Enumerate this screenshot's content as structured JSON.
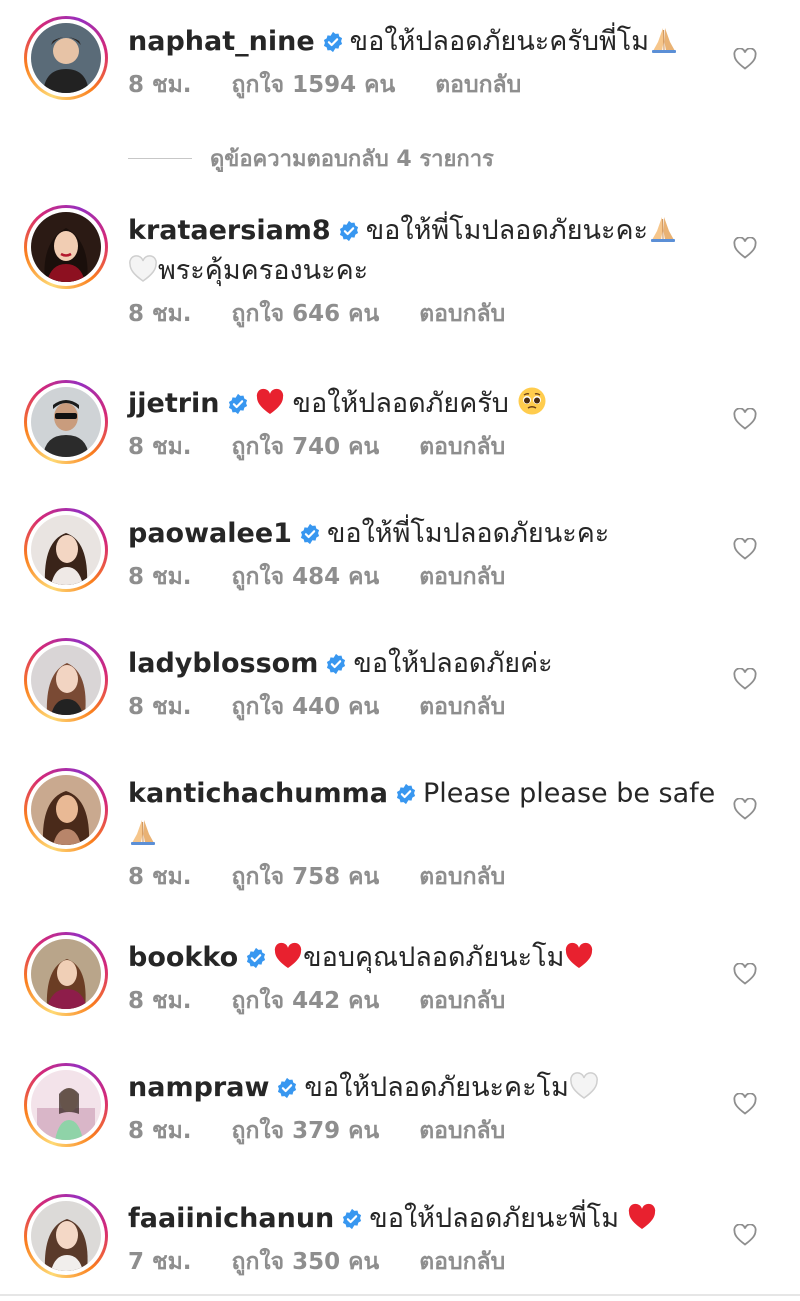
{
  "view_replies": "ดูข้อความตอบกลับ 4 รายการ",
  "reply_label": "ตอบกลับ",
  "colors": {
    "username": "#262626",
    "meta": "#8e8e8e",
    "verified": "#3897f0",
    "heart": "#ed4956"
  },
  "comments": [
    {
      "username": "naphat_nine",
      "verified": true,
      "text_lines": [
        "ขอให้ปลอดภัยนะครับพี่โม"
      ],
      "emoji": [
        "folded-hands"
      ],
      "time": "8 ชม.",
      "likes": "ถูกใจ 1594 คน"
    },
    {
      "username": "krataersiam8",
      "verified": true,
      "text_lines": [
        "ขอให้พี่โมปลอดภัยนะคะ",
        "พระคุ้มครองนะคะ"
      ],
      "emoji": [
        "folded-hands",
        "white-heart"
      ],
      "time": "8 ชม.",
      "likes": "ถูกใจ 646 คน"
    },
    {
      "username": "jjetrin",
      "verified": true,
      "text_lines": [
        "ขอให้ปลอดภัยครับ"
      ],
      "emoji": [
        "red-heart",
        "pleading-face"
      ],
      "time": "8 ชม.",
      "likes": "ถูกใจ 740 คน"
    },
    {
      "username": "paowalee1",
      "verified": true,
      "text_lines": [
        "ขอให้พี่โมปลอดภัยนะคะ"
      ],
      "emoji": [],
      "time": "8 ชม.",
      "likes": "ถูกใจ 484 คน"
    },
    {
      "username": "ladyblossom",
      "verified": true,
      "text_lines": [
        "ขอให้ปลอดภัยค่ะ"
      ],
      "emoji": [],
      "time": "8 ชม.",
      "likes": "ถูกใจ 440 คน"
    },
    {
      "username": "kantichachumma",
      "verified": true,
      "text_lines": [
        "Please please be safe"
      ],
      "emoji": [
        "folded-hands"
      ],
      "time": "8 ชม.",
      "likes": "ถูกใจ 758 คน"
    },
    {
      "username": "bookko",
      "verified": true,
      "text_lines": [
        "ขอบคุณปลอดภัยนะโม"
      ],
      "emoji": [
        "red-heart",
        "red-heart"
      ],
      "time": "8 ชม.",
      "likes": "ถูกใจ 442 คน"
    },
    {
      "username": "nampraw",
      "verified": true,
      "text_lines": [
        "ขอให้ปลอดภัยนะคะโม"
      ],
      "emoji": [
        "white-heart"
      ],
      "time": "8 ชม.",
      "likes": "ถูกใจ 379 คน"
    },
    {
      "username": "faaiinichanun",
      "verified": true,
      "text_lines": [
        "ขอให้ปลอดภัยนะพี่โม"
      ],
      "emoji": [
        "red-heart"
      ],
      "time": "7 ชม.",
      "likes": "ถูกใจ 350 คน"
    }
  ]
}
